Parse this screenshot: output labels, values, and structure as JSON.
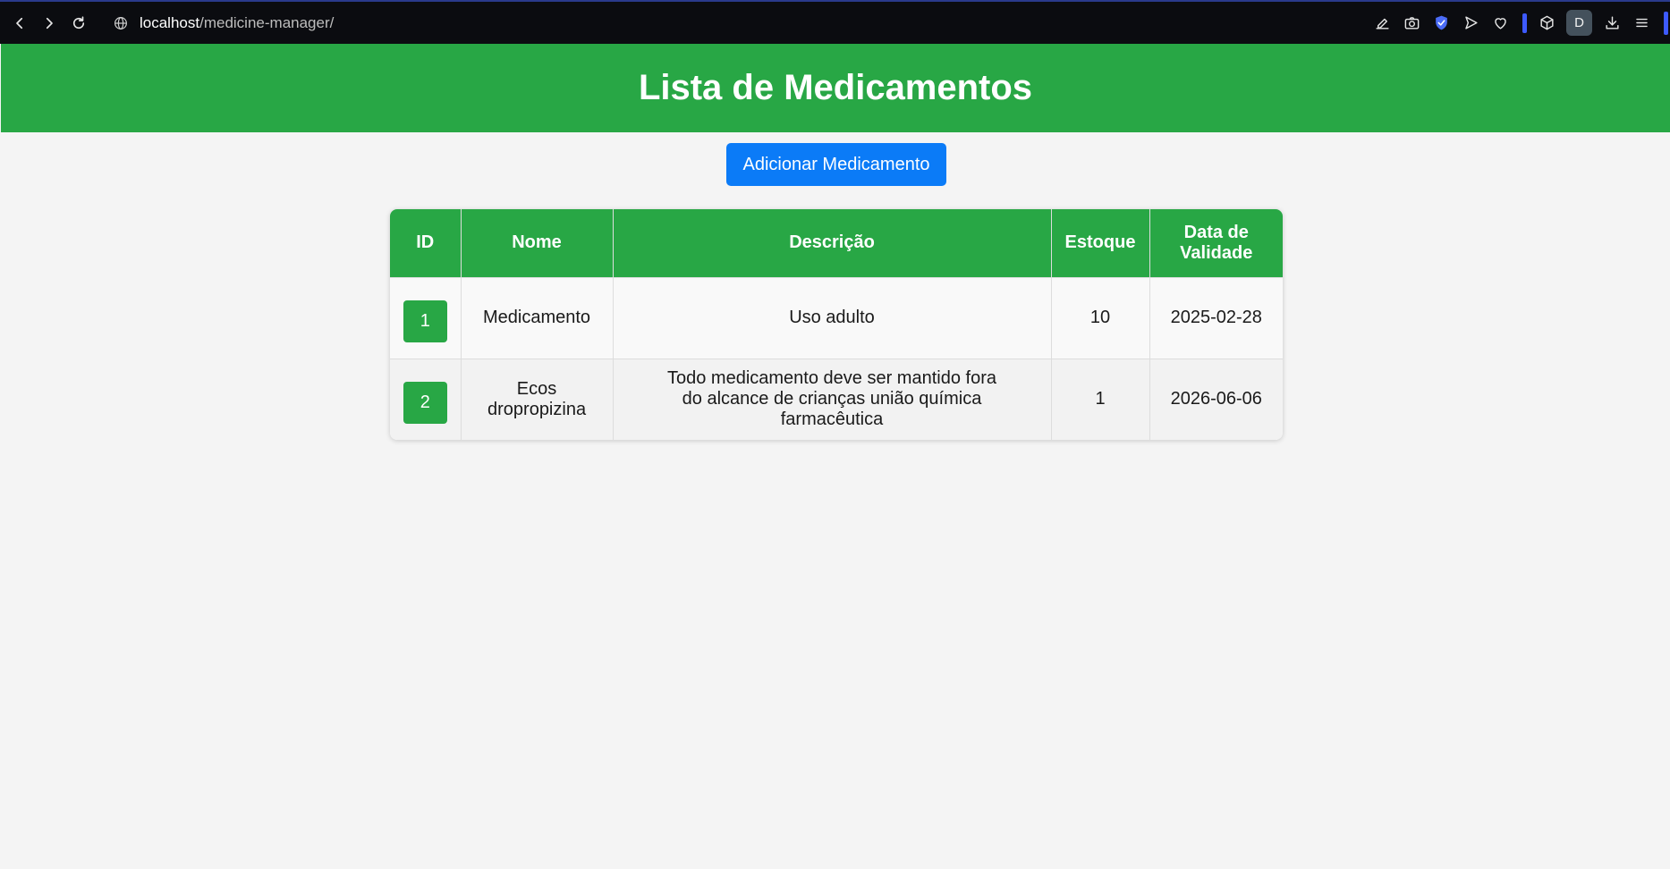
{
  "browser": {
    "url_host": "localhost",
    "url_path": "/medicine-manager/",
    "profile_initial": "D"
  },
  "header": {
    "title": "Lista de Medicamentos"
  },
  "actions": {
    "add_label": "Adicionar Medicamento"
  },
  "table": {
    "columns": [
      "ID",
      "Nome",
      "Descrição",
      "Estoque",
      "Data de Validade"
    ],
    "rows": [
      {
        "id": "1",
        "nome": "Medicamento",
        "descricao": "Uso adulto",
        "estoque": "10",
        "validade": "2025-02-28"
      },
      {
        "id": "2",
        "nome": "Ecos dropropizina",
        "descricao": "Todo medicamento deve ser mantido fora do alcance de crianças união química farmacêutica",
        "estoque": "1",
        "validade": "2026-06-06"
      }
    ]
  },
  "colors": {
    "header_green": "#28a745",
    "button_blue": "#0b7bf7",
    "background": "#f4f4f4"
  }
}
